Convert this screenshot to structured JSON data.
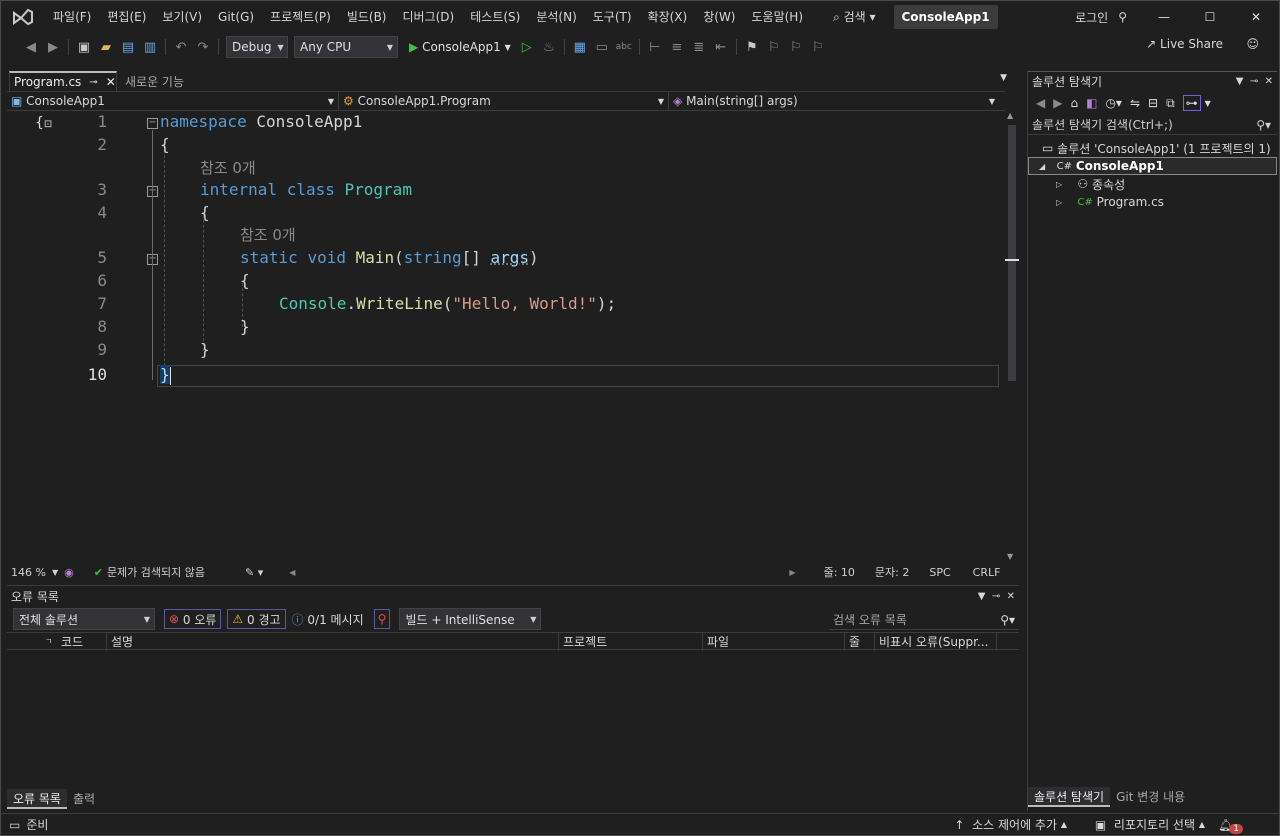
{
  "menu": {
    "items": [
      "파일(F)",
      "편집(E)",
      "보기(V)",
      "Git(G)",
      "프로젝트(P)",
      "빌드(B)",
      "디버그(D)",
      "테스트(S)",
      "분석(N)",
      "도구(T)",
      "확장(X)",
      "창(W)",
      "도움말(H)"
    ],
    "search_label": "검색",
    "project_title": "ConsoleApp1",
    "login_label": "로그인"
  },
  "toolbar": {
    "config": "Debug",
    "platform": "Any CPU",
    "run_target": "ConsoleApp1",
    "live_share": "Live Share"
  },
  "tabs": {
    "active": "Program.cs",
    "inactive": "새로운 기능"
  },
  "navbar": {
    "project": "ConsoleApp1",
    "class": "ConsoleApp1.Program",
    "member": "Main(string[] args)"
  },
  "editor": {
    "line_numbers": [
      "1",
      "2",
      "3",
      "4",
      "5",
      "6",
      "7",
      "8",
      "9",
      "10"
    ],
    "ref_label": "참조 0개",
    "code": {
      "l1_kw": "namespace",
      "l1_name": "ConsoleApp1",
      "l3_kw1": "internal",
      "l3_kw2": "class",
      "l3_type": "Program",
      "l5_kw1": "static",
      "l5_kw2": "void",
      "l5_fn": "Main",
      "l5_type": "string",
      "l5_param": "args",
      "l7_type": "Console",
      "l7_fn": "WriteLine",
      "l7_str": "\"Hello, World!\""
    }
  },
  "editor_status": {
    "zoom": "146 %",
    "issues": "문제가 검색되지 않음",
    "line": "줄: 10",
    "col": "문자: 2",
    "spc": "SPC",
    "eol": "CRLF"
  },
  "solution_explorer": {
    "title": "솔루션 탐색기",
    "search_placeholder": "솔루션 탐색기 검색(Ctrl+;)",
    "solution_label": "솔루션 'ConsoleApp1' (1 프로젝트의 1)",
    "project_label": "ConsoleApp1",
    "dependencies_label": "종속성",
    "file_label": "Program.cs",
    "bottom_tabs": [
      "솔루션 탐색기",
      "Git 변경 내용"
    ]
  },
  "error_list": {
    "title": "오류 목록",
    "scope": "전체 솔루션",
    "errors": "0 오류",
    "warnings": "0 경고",
    "messages": "0/1 메시지",
    "source": "빌드 + IntelliSense",
    "search_placeholder": "검색 오류 목록",
    "columns": [
      "코드",
      "설명",
      "프로젝트",
      "파일",
      "줄",
      "비표시 오류(Suppr..."
    ],
    "bottom_tabs": [
      "오류 목록",
      "출력"
    ]
  },
  "statusbar": {
    "ready": "준비",
    "source_control": "소스 제어에 추가",
    "repository": "리포지토리 선택",
    "notifications": "1"
  },
  "colors": {
    "accent": "#7160e8",
    "keyword": "#569cd6",
    "type": "#4ec9b0",
    "function": "#dcdcaa",
    "string": "#d69d85"
  }
}
